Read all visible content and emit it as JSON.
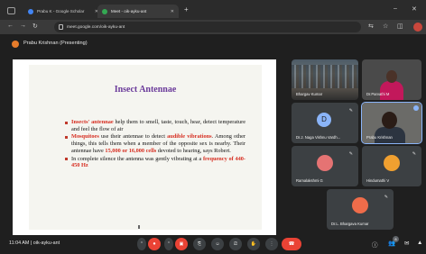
{
  "browser": {
    "tabs": [
      {
        "label": "Prabu K - Google Scholar"
      },
      {
        "label": "Meet - oik-ayku-ant"
      }
    ],
    "new_tab_icon": "plus-icon",
    "address": "meet.google.com/oik-ayku-ant"
  },
  "presenter_bar": {
    "label": "Prabu Krishnan (Presenting)"
  },
  "slide": {
    "title": "Insect Antennae",
    "bullets": [
      {
        "hl1": "Insects' antennae",
        "t1": " help them to smell, taste, touch, hear, detect temperature and feel the flow of air"
      },
      {
        "hl1": "Mosquitoes",
        "t1": " use their antennae to detect ",
        "hl2": "audible vibrations",
        "t2": ". Among other things, this tells them when a member of the opposite sex is nearby. Their antennae have ",
        "hl3": "15,000 or 16,000 cells",
        "t3": " devoted to hearing, says Robert."
      },
      {
        "t1": "In complete silence the antenna was gently vibrating at a ",
        "hl1": "frequency of 440-450 Hz"
      }
    ]
  },
  "participants": [
    {
      "name": "Bhargav Kumar"
    },
    {
      "name": "Dr.Parvathi M"
    },
    {
      "name": "Dr.J. Naga Vishnu Vardh...",
      "initial": "D"
    },
    {
      "name": "Prabu Krishnan"
    },
    {
      "name": "Ramalakshmi G"
    },
    {
      "name": "Hindumathi V"
    },
    {
      "name": "Dr.L. Bhargava Kumar"
    }
  ],
  "controls": {
    "time": "11:04 AM",
    "separator": "|",
    "meeting_code": "oik-ayku-ant",
    "participant_count": "8"
  },
  "colors": {
    "accent_red": "#ea4335",
    "title_purple": "#6a3a9a",
    "highlight_red": "#d62d20",
    "speaking_blue": "#8ab4f8"
  }
}
